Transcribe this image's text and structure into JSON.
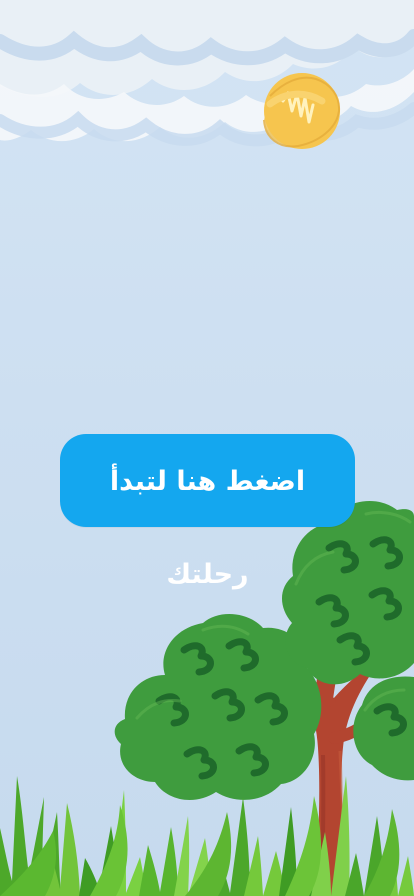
{
  "main": {
    "start_button_label": "اضغط هنا لتبدأ رحلتك"
  },
  "scene": {
    "icons": [
      "cloud-icon",
      "sun-icon",
      "tree-icon",
      "grass-icon"
    ]
  },
  "colors": {
    "sky": "#cddff1",
    "cloud": "#eaf1f7",
    "cloud_shadow": "#c3d6ea",
    "sun": "#f7c44d",
    "button": "#14a7ef",
    "tree": "#3f9b3e",
    "tree_dark": "#1e6a2a",
    "trunk": "#b0422f",
    "grass": "#72c43a"
  }
}
